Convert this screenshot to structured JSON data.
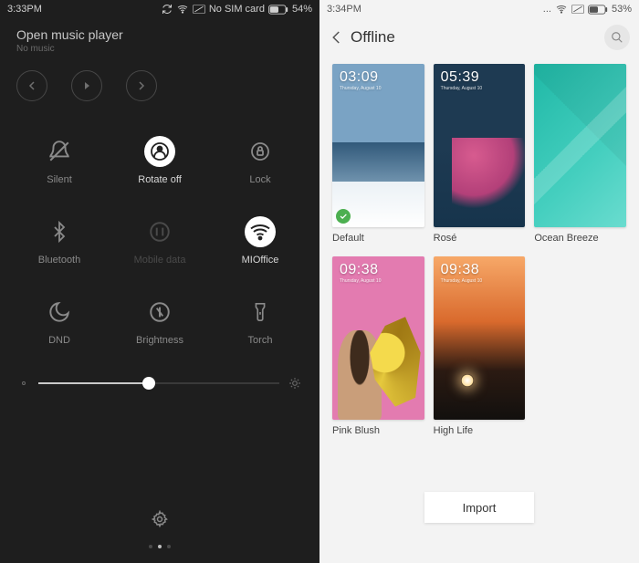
{
  "left": {
    "status": {
      "time": "3:33PM",
      "sim_text": "No SIM card",
      "battery": "54%"
    },
    "music": {
      "title": "Open music player",
      "subtitle": "No music"
    },
    "toggles": [
      {
        "key": "silent",
        "label": "Silent",
        "active": false
      },
      {
        "key": "rotate",
        "label": "Rotate off",
        "active": true
      },
      {
        "key": "lock",
        "label": "Lock",
        "active": false
      },
      {
        "key": "bluetooth",
        "label": "Bluetooth",
        "active": false
      },
      {
        "key": "mobiledata",
        "label": "Mobile data",
        "active": false,
        "dim": true
      },
      {
        "key": "wifi",
        "label": "MIOffice",
        "active": true
      },
      {
        "key": "dnd",
        "label": "DND",
        "active": false
      },
      {
        "key": "brightness",
        "label": "Brightness",
        "active": false
      },
      {
        "key": "torch",
        "label": "Torch",
        "active": false
      }
    ],
    "brightness_percent": 46
  },
  "right": {
    "status": {
      "time": "3:34PM",
      "battery": "53%"
    },
    "nav": {
      "title": "Offline"
    },
    "themes": [
      {
        "name": "Default",
        "selected": true,
        "art": "t-default",
        "clock": "03:09"
      },
      {
        "name": "Rosé",
        "selected": false,
        "art": "t-rose",
        "clock": "05:39"
      },
      {
        "name": "Ocean Breeze",
        "selected": false,
        "art": "t-ocean",
        "clock": ""
      },
      {
        "name": "Pink Blush",
        "selected": false,
        "art": "t-pink",
        "clock": "09:38"
      },
      {
        "name": "High Life",
        "selected": false,
        "art": "t-high",
        "clock": "09:38"
      }
    ],
    "import_label": "Import"
  }
}
